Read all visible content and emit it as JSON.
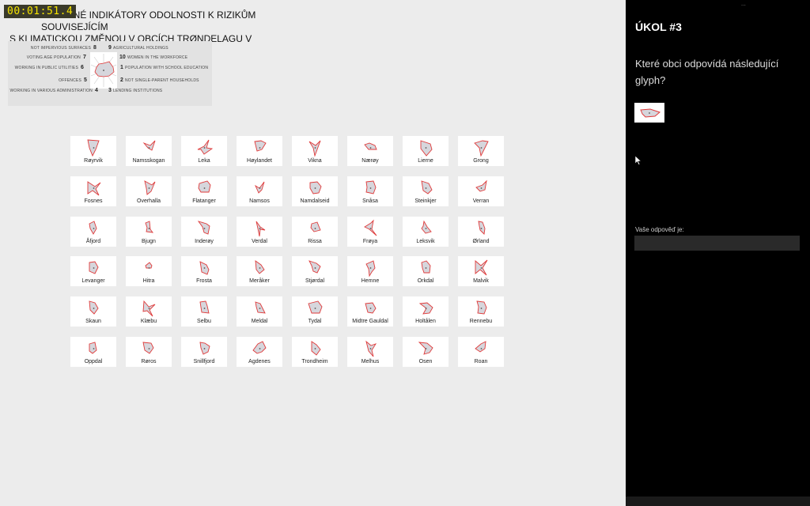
{
  "timer": "00:01:51.4",
  "title": {
    "line1": "VYBRANÉ INDIKÁTORY ODOLNOSTI K RIZIKŮM SOUVISEJÍCÍM",
    "line2": "S KLIMATICKOU ZMĚNOU V OBCÍCH TRØNDELAGU V NORSKU"
  },
  "legend": {
    "left": [
      {
        "num": "8",
        "label": "NOT IMPERVIOUS SURFACES"
      },
      {
        "num": "7",
        "label": "VOTING AGE POPULATION"
      },
      {
        "num": "6",
        "label": "WORKING IN PUBLIC UTILITIES"
      },
      {
        "num": "5",
        "label": "OFFENCES"
      },
      {
        "num": "4",
        "label": "WORKING IN VARIOUS ADMINISTRATION"
      }
    ],
    "right": [
      {
        "num": "9",
        "label": "AGRICULTURAL HOLDINGS"
      },
      {
        "num": "10",
        "label": "WOMEN IN THE WORKFORCE"
      },
      {
        "num": "1",
        "label": "POPULATION WITH SCHOOL EDUCATION"
      },
      {
        "num": "2",
        "label": "NOT SINGLE-PARENT HOUSEHOLDS"
      },
      {
        "num": "3",
        "label": "LENDING INSTITUTIONS"
      }
    ]
  },
  "municipalities": [
    "Røyrvik",
    "Namsskogan",
    "Leka",
    "Høylandet",
    "Vikna",
    "Nærøy",
    "Lierne",
    "Grong",
    "Fosnes",
    "Overhalla",
    "Flatanger",
    "Namsos",
    "Namdalseid",
    "Snåsa",
    "Steinkjer",
    "Verran",
    "Åfjord",
    "Bjugn",
    "Inderøy",
    "Verdal",
    "Rissa",
    "Frøya",
    "Leksvik",
    "Ørland",
    "Levanger",
    "Hitra",
    "Frosta",
    "Meråker",
    "Stjørdal",
    "Hemne",
    "Orkdal",
    "Malvik",
    "Skaun",
    "Klæbu",
    "Selbu",
    "Meldal",
    "Tydal",
    "Midtre Gauldal",
    "Holtålen",
    "Rennebu",
    "Oppdal",
    "Røros",
    "Snillfjord",
    "Agdenes",
    "Trondheim",
    "Melhus",
    "Osen",
    "Roan"
  ],
  "sidebar": {
    "dots": "...",
    "task": "ÚKOL #3",
    "question": "Které obci odpovídá následující glyph?",
    "answer_label": "Vaše odpověď je:",
    "answer_value": ""
  },
  "colors": {
    "glyph_stroke": "#e03a3a",
    "glyph_fill": "#d6d6dc",
    "sidebar_bg": "#000000"
  }
}
